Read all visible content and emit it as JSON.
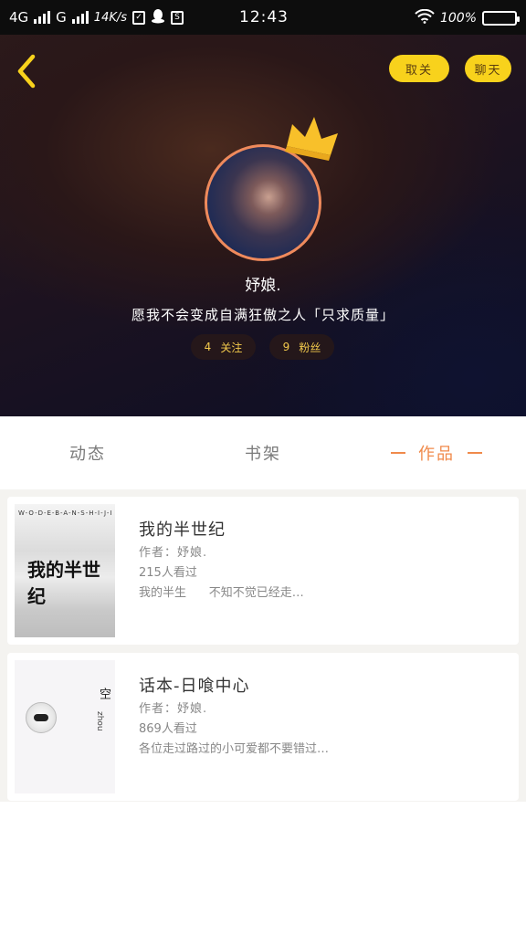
{
  "status_bar": {
    "network_1": "4G",
    "network_2": "G",
    "speed": "14K/s",
    "time": "12:43",
    "battery": "100%",
    "icons": [
      "signal-icon",
      "signal-icon",
      "check-icon",
      "qq-icon",
      "s-icon",
      "wifi-icon",
      "battery-icon"
    ]
  },
  "header": {
    "follow_button": "取关",
    "chat_button": "聊天",
    "nickname": "妤娘.",
    "signature": "愿我不会变成自满狂傲之人「只求质量」",
    "stats": [
      {
        "count": "4",
        "label": "关注"
      },
      {
        "count": "9",
        "label": "粉丝"
      }
    ]
  },
  "tabs": [
    {
      "label": "动态",
      "active": false
    },
    {
      "label": "书架",
      "active": false
    },
    {
      "label": "作品",
      "active": true
    }
  ],
  "works": [
    {
      "title": "我的半世纪",
      "author": "作者：妤娘.",
      "views": "215人看过",
      "description": "我的半生      不知不觉已经走…",
      "cover_top_text": "W-O-D-E-B-A-N-S-H-I-J-I",
      "cover_title": "我的半世纪"
    },
    {
      "title": "话本-日喰中心",
      "author": "作者：妤娘.",
      "views": "869人看过",
      "description": "各位走过路过的小可爱都不要错过…",
      "cover_text": "空",
      "cover_text_2": "zhou"
    }
  ],
  "colors": {
    "accent": "#f08a4b",
    "pill": "#f8d21c",
    "stat_text": "#f2c94c"
  }
}
